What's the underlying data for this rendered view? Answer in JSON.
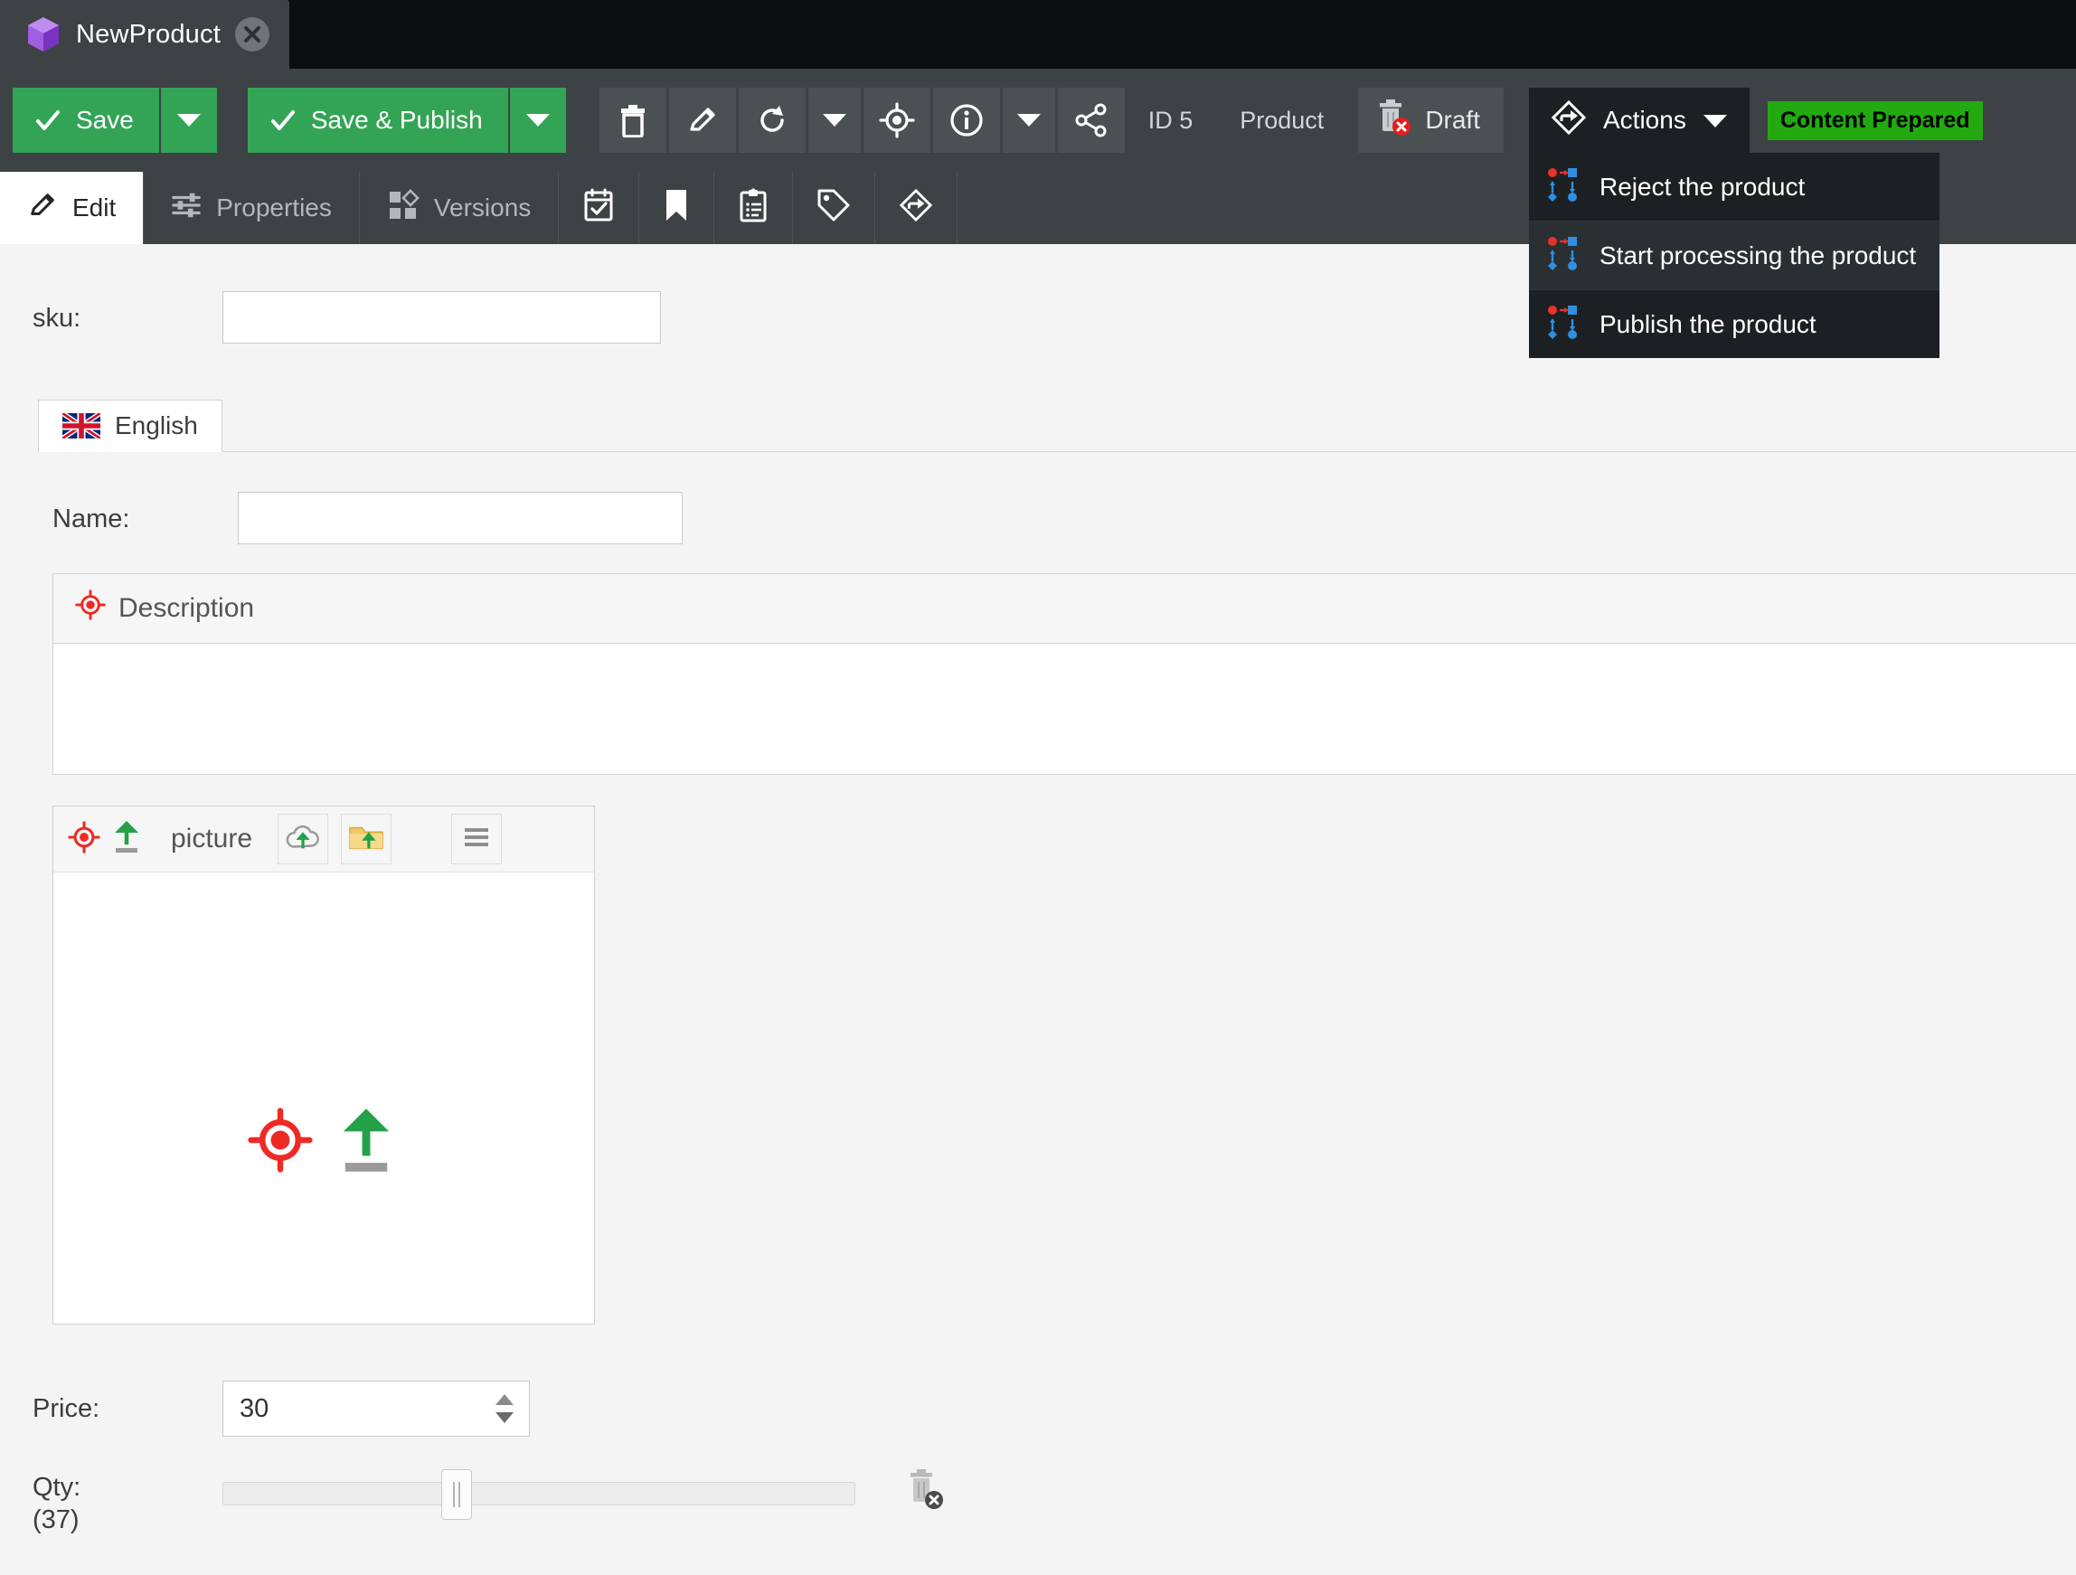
{
  "window": {
    "tab_title": "NewProduct",
    "tab_icon": "cube-icon",
    "close_icon": "close-icon"
  },
  "toolbar": {
    "save_label": "Save",
    "save_publish_label": "Save & Publish",
    "id_label": "ID 5",
    "type_label": "Product",
    "draft_label": "Draft",
    "actions_label": "Actions",
    "status_badge": "Content Prepared",
    "icons": [
      "delete-icon",
      "edit-icon",
      "refresh-icon",
      "chevron-down-icon",
      "target-icon",
      "info-icon",
      "chevron-down-icon",
      "share-icon"
    ],
    "colors": {
      "save_green": "#33a456",
      "badge_green": "#22aa10",
      "toolbar_bg": "#3d4245",
      "actions_bg": "#1c2023"
    }
  },
  "actions_menu": {
    "items": [
      {
        "label": "Reject the product",
        "icon": "workflow-icon",
        "highlighted": false
      },
      {
        "label": "Start processing the product",
        "icon": "workflow-icon",
        "highlighted": true
      },
      {
        "label": "Publish the product",
        "icon": "workflow-icon",
        "highlighted": false
      }
    ]
  },
  "tabs": [
    {
      "label": "Edit",
      "icon": "edit-pencil-icon",
      "active": true
    },
    {
      "label": "Properties",
      "icon": "sliders-icon",
      "active": false
    },
    {
      "label": "Versions",
      "icon": "shapes-icon",
      "active": false
    },
    {
      "label": "",
      "icon": "calendar-check-icon",
      "active": false
    },
    {
      "label": "",
      "icon": "bookmark-icon",
      "active": false
    },
    {
      "label": "",
      "icon": "clipboard-list-icon",
      "active": false
    },
    {
      "label": "",
      "icon": "tag-icon",
      "active": false
    },
    {
      "label": "",
      "icon": "workflow-diamond-icon",
      "active": false
    }
  ],
  "form": {
    "sku": {
      "label": "sku:",
      "value": "",
      "placeholder": ""
    },
    "language_tab": {
      "label": "English",
      "icon": "uk-flag-icon"
    },
    "name": {
      "label": "Name:",
      "value": "",
      "placeholder": ""
    },
    "description": {
      "label": "Description",
      "icon": "target-icon",
      "value": ""
    },
    "picture": {
      "label": "picture",
      "target_icon": "target-icon",
      "upload_icon": "upload-arrow-icon",
      "cloud_upload_icon": "cloud-upload-icon",
      "folder_upload_icon": "folder-upload-icon",
      "menu_icon": "hamburger-menu-icon",
      "dropzone_icons": [
        "target-icon",
        "upload-arrow-icon"
      ]
    },
    "price": {
      "label": "Price:",
      "value": "30"
    },
    "qty": {
      "label": "Qty:",
      "sublabel": "(37)",
      "value": 37,
      "min": 0,
      "max": 100,
      "clear_icon": "delete-value-icon"
    }
  }
}
